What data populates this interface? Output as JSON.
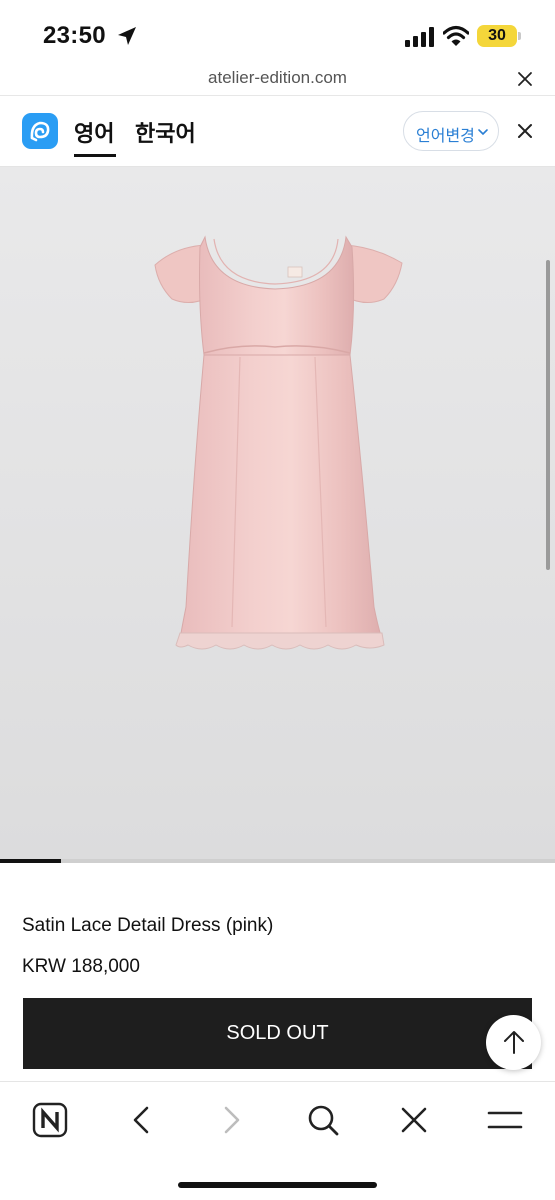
{
  "status_bar": {
    "time": "23:50",
    "battery": "30",
    "battery_color": "#f4d63a"
  },
  "url_bar": {
    "domain": "atelier-edition.com",
    "close_icon": "close-icon"
  },
  "translate_bar": {
    "logo_icon": "translate-logo-icon",
    "active_language": "영어",
    "other_language": "한국어",
    "change_language_label": "언어변경",
    "accent_color": "#2a9df4"
  },
  "product": {
    "image_description_icon": "dress-image",
    "gallery_progress": 0.11,
    "name": "Satin Lace Detail Dress (pink)",
    "price": "KRW 188,000",
    "action_label": "SOLD OUT"
  },
  "toolbar": {
    "items": [
      "naver-home-icon",
      "back-icon",
      "forward-icon",
      "search-icon",
      "close-icon",
      "menu-icon"
    ]
  }
}
